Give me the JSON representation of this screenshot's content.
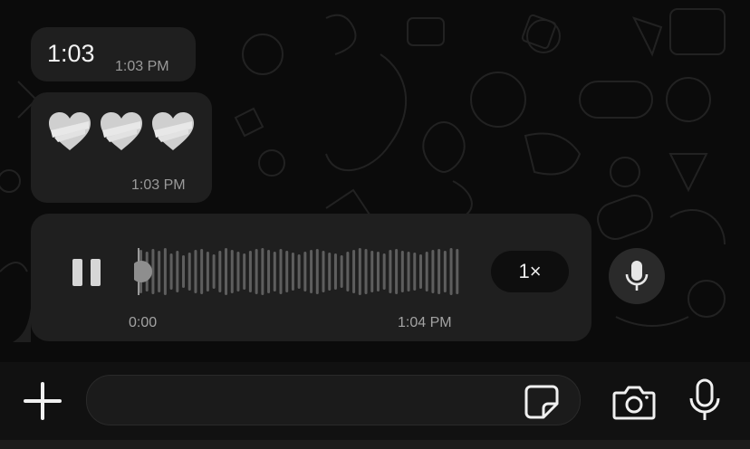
{
  "chat": {
    "messages": [
      {
        "text": "1:03",
        "time": "1:03 PM"
      },
      {
        "emoji": "🩶🩶🩶",
        "time": "1:03 PM"
      }
    ],
    "voice_note": {
      "elapsed": "0:00",
      "time": "1:04 PM",
      "speed": "1×",
      "progress": 0.0,
      "state": "playing"
    }
  },
  "composer": {
    "placeholder": "",
    "icons": [
      "plus-icon",
      "sticker-icon",
      "camera-icon",
      "microphone-icon"
    ]
  },
  "colors": {
    "background": "#0b0b0b",
    "bubble": "#1f1f1f",
    "muted_text": "#9a9a9a",
    "accent": "#d6d6d6"
  }
}
